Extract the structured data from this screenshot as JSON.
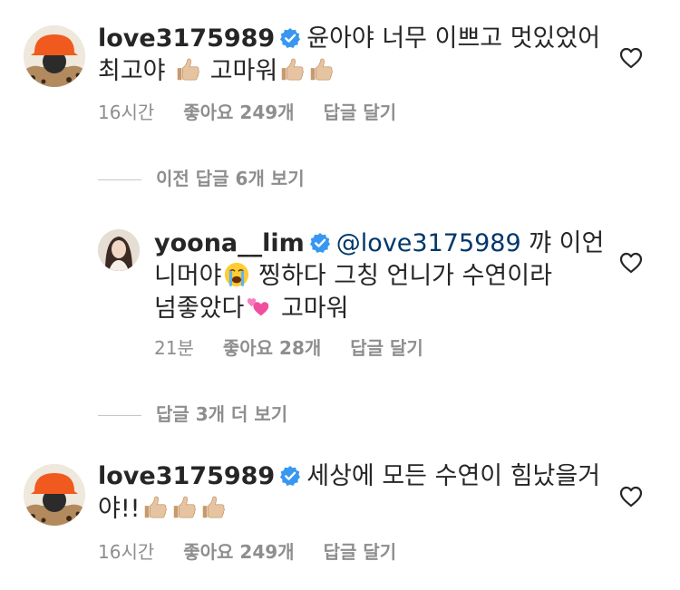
{
  "comments": [
    {
      "username": "love3175989",
      "verified": true,
      "text_1": "윤아야 너무 이쁘고 멋있었어",
      "text_2a": "최고야",
      "text_2b": "고마워",
      "time": "16시간",
      "likes": "좋아요 249개",
      "reply": "답글 달기"
    },
    {
      "username": "yoona__lim",
      "verified": true,
      "mention": "@love3175989",
      "text_1": "꺄 이언",
      "text_2a": "니머야",
      "text_2b": "찡하다 그칭  언니가 수연이라",
      "text_3a": "넘좋았다",
      "text_3b": "고마워",
      "time": "21분",
      "likes": "좋아요 28개",
      "reply": "답글 달기"
    },
    {
      "username": "love3175989",
      "verified": true,
      "text_1": "세상에 모든 수연이 힘났을거",
      "text_2a": "야!!",
      "time": "16시간",
      "likes": "좋아요 249개",
      "reply": "답글 달기"
    }
  ],
  "view_previous": "이전 답글 6개 보기",
  "view_more": "답글 3개 더 보기",
  "icons": {
    "verified": "verified-badge-icon",
    "like": "heart-outline-icon",
    "thumbs": "thumbs-up-emoji",
    "crying": "loudly-crying-face-emoji",
    "hearts": "two-hearts-emoji"
  },
  "colors": {
    "verified_blue": "#3897f0",
    "meta_gray": "#8e8e8e",
    "mention": "#00376b"
  }
}
